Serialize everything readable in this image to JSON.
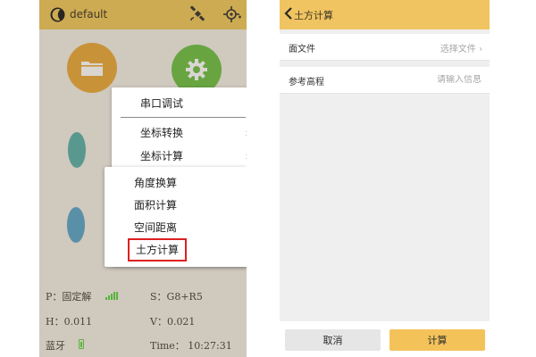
{
  "left_screen": {
    "header": {
      "title": "default",
      "brand_color": "#f0c85c"
    },
    "icons": {
      "logo": "moon-logo-icon",
      "satellite": "satellite-icon",
      "gps": "gps-target-icon",
      "files_app": "folder-icon",
      "settings_app": "gear-icon"
    },
    "menu": {
      "items": [
        {
          "label": "串口调试"
        },
        {
          "label": "坐标转换"
        },
        {
          "label": "坐标计算"
        }
      ]
    },
    "submenu": {
      "items": [
        {
          "label": "角度换算"
        },
        {
          "label": "面积计算"
        },
        {
          "label": "空间距离"
        },
        {
          "label": "土方计算"
        }
      ],
      "highlight_color": "#dd2020"
    },
    "status": {
      "position": "P：固定解",
      "satellites": "S：G8+R5",
      "h_precision": "H：0.011",
      "v_precision": "V：0.021",
      "bluetooth": "蓝牙",
      "time": "Time： 10:27:31"
    }
  },
  "right_screen": {
    "header": {
      "title": "土方计算",
      "brand_color": "#f0c460"
    },
    "form": {
      "surface_file": {
        "label": "面文件",
        "value": "选择文件"
      },
      "ref_elevation": {
        "label": "参考高程",
        "placeholder": "请输入信息"
      }
    },
    "buttons": {
      "cancel": "取消",
      "calculate": "计算"
    }
  }
}
